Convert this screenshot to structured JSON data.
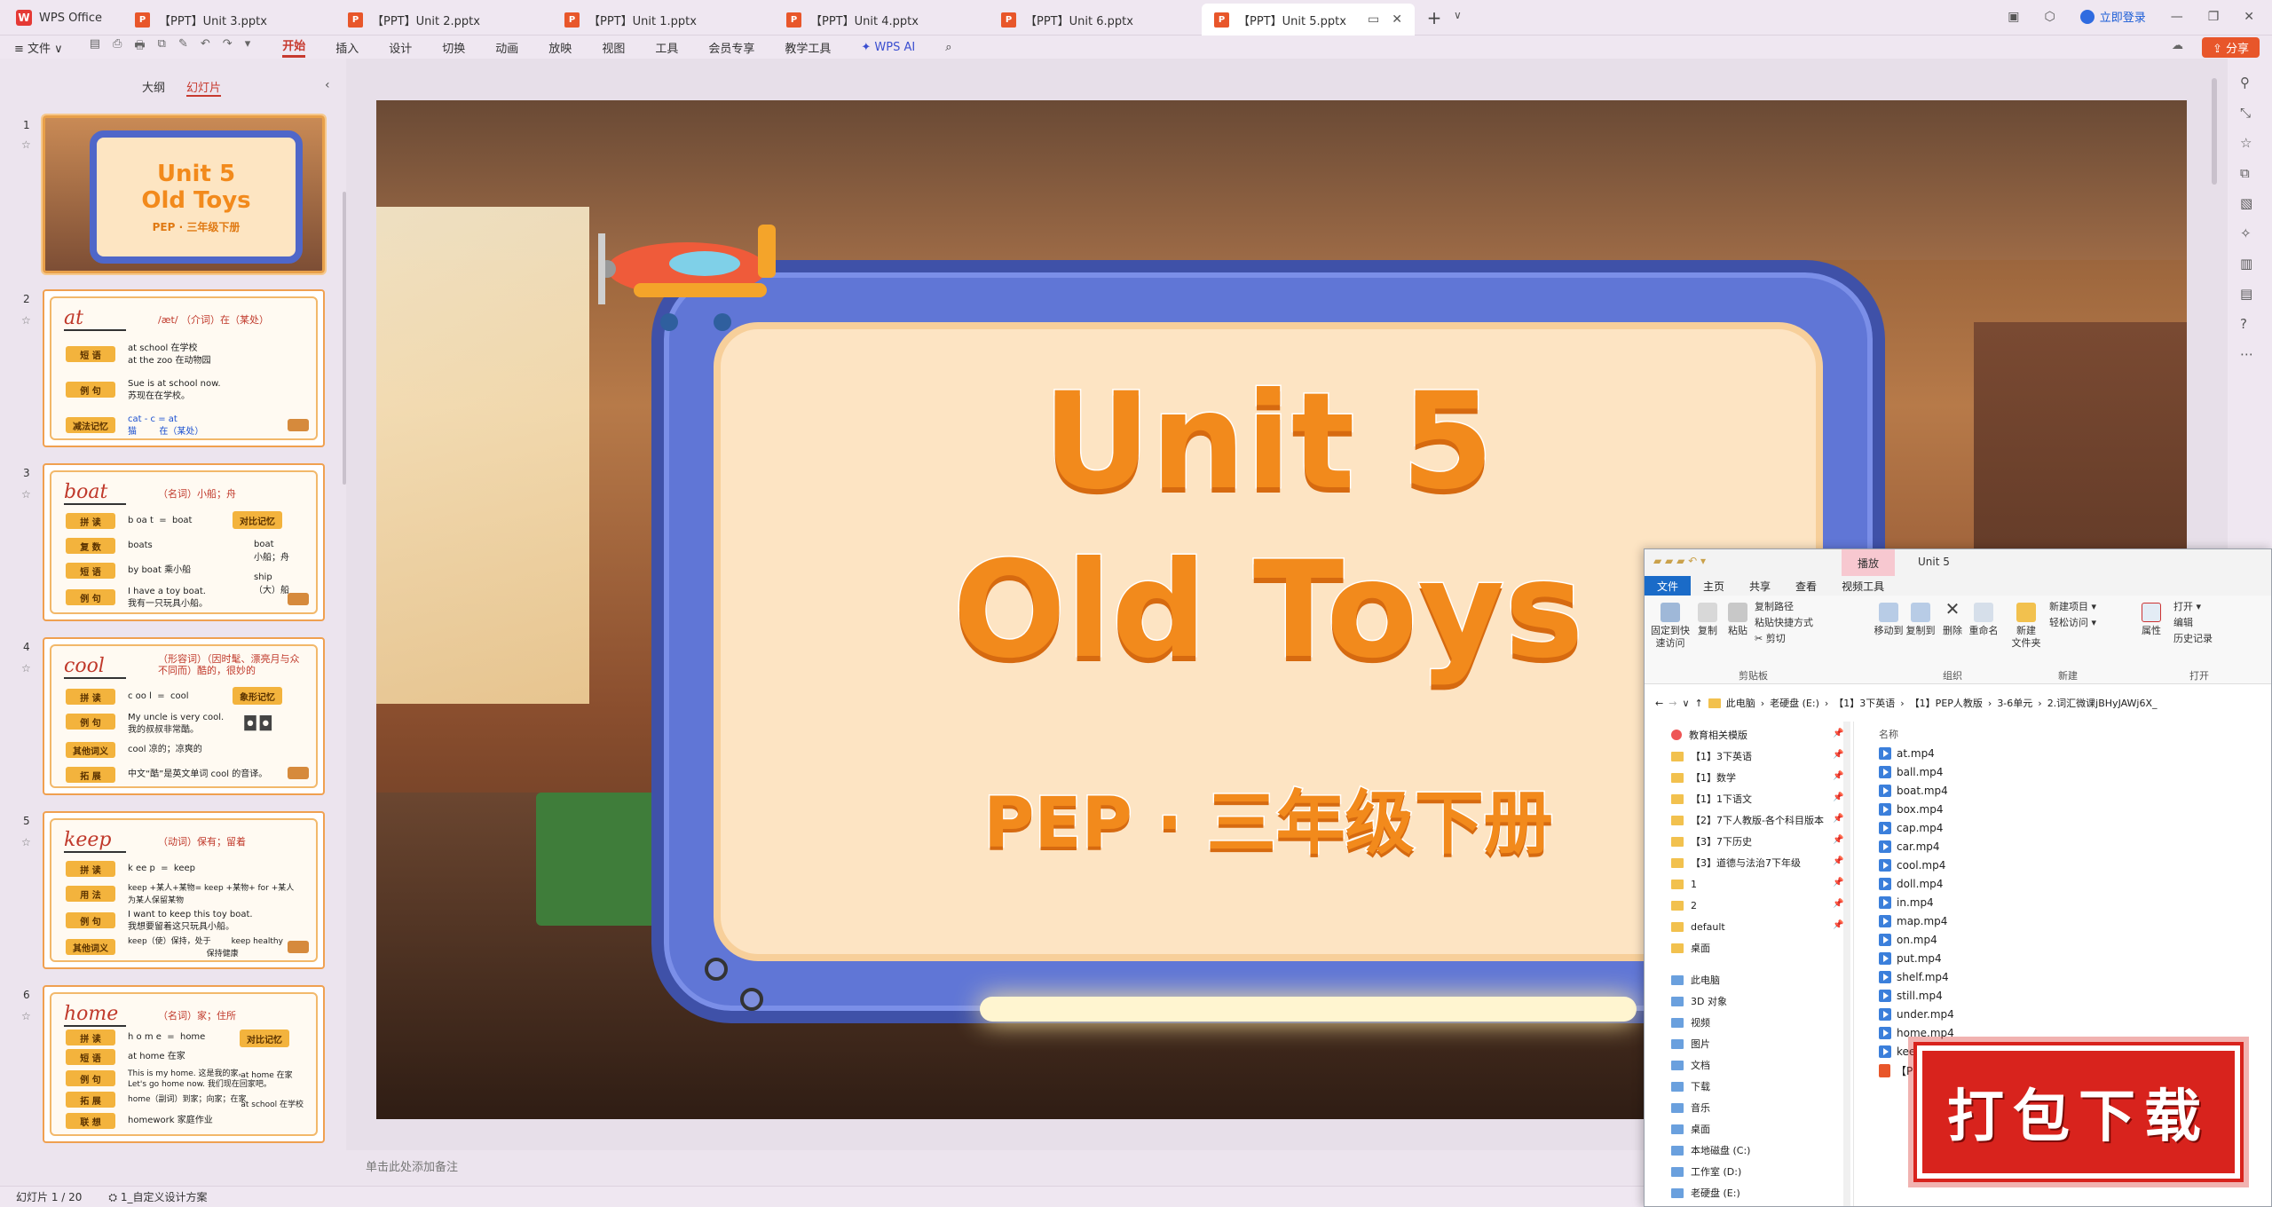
{
  "titlebar": {
    "app_name": "WPS Office",
    "tabs": [
      {
        "label": "【PPT】Unit 3.pptx"
      },
      {
        "label": "【PPT】Unit 2.pptx"
      },
      {
        "label": "【PPT】Unit 1.pptx"
      },
      {
        "label": "【PPT】Unit 4.pptx"
      },
      {
        "label": "【PPT】Unit 6.pptx"
      },
      {
        "label": "【PPT】Unit 5.pptx"
      }
    ],
    "login": "立即登录"
  },
  "menubar": {
    "file": "≡ 文件 ∨",
    "items": [
      "开始",
      "插入",
      "设计",
      "切换",
      "动画",
      "放映",
      "视图",
      "工具",
      "会员专享",
      "教学工具"
    ],
    "wps_ai": "WPS AI",
    "share": "分享"
  },
  "leftpanel": {
    "tab_outline": "大纲",
    "tab_slides": "幻灯片",
    "slides": [
      {
        "no": "1",
        "unit": "Unit 5",
        "title": "Old Toys",
        "sub": "PEP · 三年级下册"
      },
      {
        "no": "2",
        "word": "at",
        "def": "/æt/  （介词）在（某处）",
        "rows": [
          {
            "label": "短 语",
            "text": "at school 在学校\nat the zoo 在动物园"
          },
          {
            "label": "例 句",
            "text": "Sue is at school now.\n苏现在在学校。"
          },
          {
            "label": "减法记忆",
            "text": "cat - c = at\n猫        在（某处）"
          }
        ]
      },
      {
        "no": "3",
        "word": "boat",
        "def": "（名词）小船；舟",
        "rows": [
          {
            "label": "拼 读",
            "text": "b oa t  =  boat"
          },
          {
            "label": "复 数",
            "text": "boats"
          },
          {
            "label": "短 语",
            "text": "by boat 乘小船"
          },
          {
            "label": "例 句",
            "text": "I have a toy boat.\n我有一只玩具小船。"
          }
        ],
        "badge": "对比记忆",
        "right": "boat\n小船；舟\n\nship\n（大）船"
      },
      {
        "no": "4",
        "word": "cool",
        "def": "（形容词）（因时髦、漂亮月与众\n不同而）酷的，很妙的",
        "rows": [
          {
            "label": "拼 读",
            "text": "c oo l  =  cool"
          },
          {
            "label": "例 句",
            "text": "My uncle is very cool.\n我的叔叔非常酷。"
          },
          {
            "label": "其他词义",
            "text": "cool 凉的；凉爽的"
          },
          {
            "label": "拓 展",
            "text": "中文“酷”是英文单词 cool 的音译。"
          }
        ],
        "badge": "象形记忆",
        "right": ""
      },
      {
        "no": "5",
        "word": "keep",
        "def": "（动词）保有；留着",
        "rows": [
          {
            "label": "拼 读",
            "text": "k ee p  =  keep"
          },
          {
            "label": "用 法",
            "text": "keep +某人+某物= keep +某物+ for +某人\n为某人保留某物"
          },
          {
            "label": "例 句",
            "text": "I want to keep this toy boat.\n我想要留着这只玩具小船。"
          },
          {
            "label": "其他词义",
            "text": "keep（使）保持，处于        keep healthy\n                               保持健康"
          }
        ]
      },
      {
        "no": "6",
        "word": "home",
        "def": "（名词）家；住所",
        "rows": [
          {
            "label": "拼 读",
            "text": "h o m e  =  home"
          },
          {
            "label": "短 语",
            "text": "at home 在家"
          },
          {
            "label": "例 句",
            "text": "This is my home. 这是我的家。\nLet's go home now. 我们现在回家吧。"
          },
          {
            "label": "拓 展",
            "text": "home（副词）到家；向家；在家"
          },
          {
            "label": "联 想",
            "text": "homework 家庭作业"
          }
        ],
        "badge": "对比记忆",
        "right": "at home 在家\n\n\nat school 在学校"
      }
    ]
  },
  "slide": {
    "line1": "Unit 5",
    "line2": "Old Toys",
    "line3": "PEP · 三年级下册"
  },
  "notes_placeholder": "单击此处添加备注",
  "statusbar": {
    "slide_info": "幻灯片 1 / 20",
    "design": "1_自定义设计方案"
  },
  "explorer": {
    "title_tab": "播放",
    "title_name": "Unit 5",
    "tabs": [
      "文件",
      "主页",
      "共享",
      "查看",
      "视频工具"
    ],
    "ribbon": {
      "pin": "固定到快\n速访问",
      "copy": "复制",
      "paste": "粘贴",
      "copy_path": "复制路径",
      "paste_shortcut": "粘贴快捷方式",
      "cut": "剪切",
      "move_to": "移动到",
      "copy_to": "复制到",
      "delete": "删除",
      "rename": "重命名",
      "new_folder": "新建\n文件夹",
      "new_item": "新建项目 ▾",
      "easy_access": "轻松访问 ▾",
      "properties": "属性",
      "open": "打开 ▾",
      "edit": "编辑",
      "history": "历史记录",
      "grp_clipboard": "剪贴板",
      "grp_organize": "组织",
      "grp_new": "新建",
      "grp_open": "打开"
    },
    "address": [
      "此电脑",
      "老硬盘 (E:)",
      "【1】3下英语",
      "【1】PEP人教版",
      "3-6单元",
      "2.词汇微课jBHyJAWj6X_"
    ],
    "nav": [
      "教育相关模版",
      "【1】3下英语",
      "【1】数学",
      "【1】1下语文",
      "【2】7下人教版-各个科目版本",
      "【3】7下历史",
      "【3】道德与法治7下年级",
      "1",
      "2",
      "default",
      "桌面",
      "此电脑",
      "3D 对象",
      "视频",
      "图片",
      "文档",
      "下载",
      "音乐",
      "桌面",
      "本地磁盘 (C:)",
      "工作室 (D:)",
      "老硬盘 (E:)"
    ],
    "col_name": "名称",
    "files": [
      "at.mp4",
      "ball.mp4",
      "boat.mp4",
      "box.mp4",
      "cap.mp4",
      "car.mp4",
      "cool.mp4",
      "doll.mp4",
      "in.mp4",
      "map.mp4",
      "on.mp4",
      "put.mp4",
      "shelf.mp4",
      "still.mp4",
      "under.mp4",
      "home.mp4",
      "keep.mp4",
      "【PPT】Unit 5.pptx"
    ]
  },
  "download_badge": "打包下载"
}
